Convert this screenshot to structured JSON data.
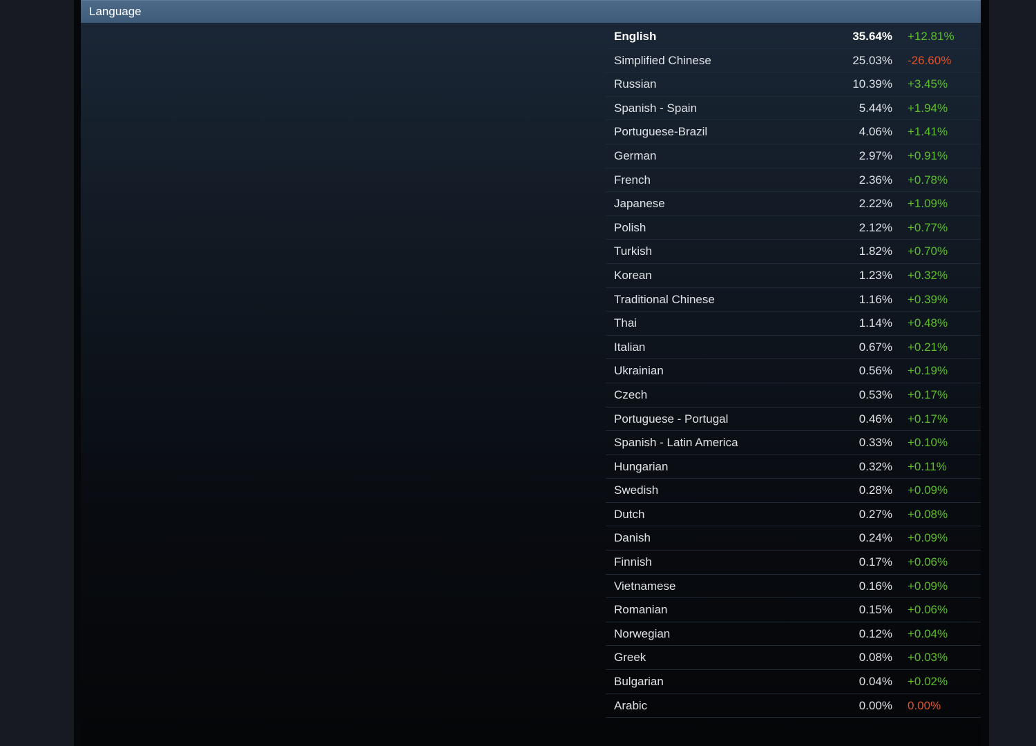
{
  "header": {
    "title": "Language"
  },
  "colors": {
    "positive": "#5cbf2a",
    "negative": "#e1522a",
    "header_bg": "#4d6a88"
  },
  "languages": [
    {
      "name": "English",
      "percent": "35.64%",
      "change": "+12.81%",
      "trend": "up"
    },
    {
      "name": "Simplified Chinese",
      "percent": "25.03%",
      "change": "-26.60%",
      "trend": "down"
    },
    {
      "name": "Russian",
      "percent": "10.39%",
      "change": "+3.45%",
      "trend": "up"
    },
    {
      "name": "Spanish - Spain",
      "percent": "5.44%",
      "change": "+1.94%",
      "trend": "up"
    },
    {
      "name": "Portuguese-Brazil",
      "percent": "4.06%",
      "change": "+1.41%",
      "trend": "up"
    },
    {
      "name": "German",
      "percent": "2.97%",
      "change": "+0.91%",
      "trend": "up"
    },
    {
      "name": "French",
      "percent": "2.36%",
      "change": "+0.78%",
      "trend": "up"
    },
    {
      "name": "Japanese",
      "percent": "2.22%",
      "change": "+1.09%",
      "trend": "up"
    },
    {
      "name": "Polish",
      "percent": "2.12%",
      "change": "+0.77%",
      "trend": "up"
    },
    {
      "name": "Turkish",
      "percent": "1.82%",
      "change": "+0.70%",
      "trend": "up"
    },
    {
      "name": "Korean",
      "percent": "1.23%",
      "change": "+0.32%",
      "trend": "up"
    },
    {
      "name": "Traditional Chinese",
      "percent": "1.16%",
      "change": "+0.39%",
      "trend": "up"
    },
    {
      "name": "Thai",
      "percent": "1.14%",
      "change": "+0.48%",
      "trend": "up"
    },
    {
      "name": "Italian",
      "percent": "0.67%",
      "change": "+0.21%",
      "trend": "up"
    },
    {
      "name": "Ukrainian",
      "percent": "0.56%",
      "change": "+0.19%",
      "trend": "up"
    },
    {
      "name": "Czech",
      "percent": "0.53%",
      "change": "+0.17%",
      "trend": "up"
    },
    {
      "name": "Portuguese - Portugal",
      "percent": "0.46%",
      "change": "+0.17%",
      "trend": "up"
    },
    {
      "name": "Spanish - Latin America",
      "percent": "0.33%",
      "change": "+0.10%",
      "trend": "up"
    },
    {
      "name": "Hungarian",
      "percent": "0.32%",
      "change": "+0.11%",
      "trend": "up"
    },
    {
      "name": "Swedish",
      "percent": "0.28%",
      "change": "+0.09%",
      "trend": "up"
    },
    {
      "name": "Dutch",
      "percent": "0.27%",
      "change": "+0.08%",
      "trend": "up"
    },
    {
      "name": "Danish",
      "percent": "0.24%",
      "change": "+0.09%",
      "trend": "up"
    },
    {
      "name": "Finnish",
      "percent": "0.17%",
      "change": "+0.06%",
      "trend": "up"
    },
    {
      "name": "Vietnamese",
      "percent": "0.16%",
      "change": "+0.09%",
      "trend": "up"
    },
    {
      "name": "Romanian",
      "percent": "0.15%",
      "change": "+0.06%",
      "trend": "up"
    },
    {
      "name": "Norwegian",
      "percent": "0.12%",
      "change": "+0.04%",
      "trend": "up"
    },
    {
      "name": "Greek",
      "percent": "0.08%",
      "change": "+0.03%",
      "trend": "up"
    },
    {
      "name": "Bulgarian",
      "percent": "0.04%",
      "change": "+0.02%",
      "trend": "up"
    },
    {
      "name": "Arabic",
      "percent": "0.00%",
      "change": "0.00%",
      "trend": "down"
    }
  ]
}
